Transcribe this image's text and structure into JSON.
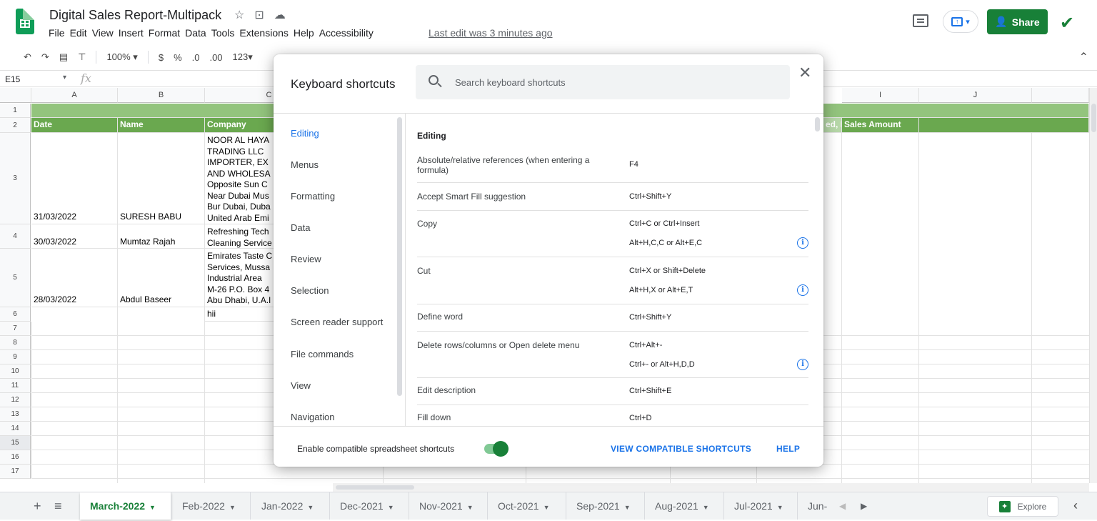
{
  "app": {
    "doc_title": "Digital Sales Report-Multipack",
    "menu": [
      "File",
      "Edit",
      "View",
      "Insert",
      "Format",
      "Data",
      "Tools",
      "Extensions",
      "Help",
      "Accessibility"
    ],
    "last_edit": "Last edit was 3 minutes ago",
    "share_label": "Share"
  },
  "toolbar": {
    "zoom": "100%",
    "currency": "$",
    "percent": "%",
    "dec_less": ".0",
    "dec_more": ".00",
    "format_num": "123"
  },
  "formula_bar": {
    "name_box": "E15",
    "fx": "fx"
  },
  "sheet": {
    "columns": [
      "A",
      "B",
      "C",
      "I",
      "J"
    ],
    "row_numbers": [
      "1",
      "2",
      "3",
      "4",
      "5",
      "6",
      "7",
      "8",
      "9",
      "10",
      "11",
      "12",
      "13",
      "14",
      "15",
      "16",
      "17"
    ],
    "header_row": {
      "a": "Date",
      "b": "Name",
      "c": "Company",
      "h": "ed, P",
      "i": "Sales Amount"
    },
    "rows": [
      {
        "a": "31/03/2022",
        "b": "SURESH BABU",
        "c": "NOOR AL HAYA\nTRADING LLC\nIMPORTER, EX\nAND WHOLESA\nOpposite Sun C\nNear Dubai Mus\nBur Dubai, Duba\nUnited Arab Emi"
      },
      {
        "a": "30/03/2022",
        "b": "Mumtaz Rajah",
        "c": "Refreshing Tech\nCleaning Service"
      },
      {
        "a": "28/03/2022",
        "b": "Abdul Baseer",
        "c": "Emirates Taste C\nServices, Mussa\nIndustrial Area\nM-26 P.O. Box 4\nAbu Dhabi, U.A.I"
      },
      {
        "a": "",
        "b": "",
        "c": "hii"
      }
    ]
  },
  "tabs": {
    "items": [
      "March-2022",
      "Feb-2022",
      "Jan-2022",
      "Dec-2021",
      "Nov-2021",
      "Oct-2021",
      "Sep-2021",
      "Aug-2021",
      "Jul-2021",
      "Jun-"
    ],
    "explore_label": "Explore"
  },
  "dialog": {
    "title": "Keyboard shortcuts",
    "search_placeholder": "Search keyboard shortcuts",
    "categories": [
      "Editing",
      "Menus",
      "Formatting",
      "Data",
      "Review",
      "Selection",
      "Screen reader support",
      "File commands",
      "View",
      "Navigation"
    ],
    "section_title": "Editing",
    "shortcuts": [
      {
        "desc": "Absolute/relative references (when entering a formula)",
        "key1": "F4",
        "key2": "",
        "info": false
      },
      {
        "desc": "Accept Smart Fill suggestion",
        "key1": "Ctrl+Shift+Y",
        "key2": "",
        "info": false
      },
      {
        "desc": "Copy",
        "key1": "Ctrl+C or Ctrl+Insert",
        "key2": "Alt+H,C,C or Alt+E,C",
        "info": true
      },
      {
        "desc": "Cut",
        "key1": "Ctrl+X or Shift+Delete",
        "key2": "Alt+H,X or Alt+E,T",
        "info": true
      },
      {
        "desc": "Define word",
        "key1": "Ctrl+Shift+Y",
        "key2": "",
        "info": false
      },
      {
        "desc": "Delete rows/columns or Open delete menu",
        "key1": "Ctrl+Alt+-",
        "key2": "Ctrl+- or Alt+H,D,D",
        "info": true
      },
      {
        "desc": "Edit description",
        "key1": "Ctrl+Shift+E",
        "key2": "",
        "info": false
      },
      {
        "desc": "Fill down",
        "key1": "Ctrl+D",
        "key2": "",
        "info": false
      }
    ],
    "footer": {
      "toggle_label": "Enable compatible spreadsheet shortcuts",
      "toggle_on": true,
      "view_compat": "VIEW COMPATIBLE SHORTCUTS",
      "help": "HELP"
    }
  },
  "colors": {
    "brand_green": "#188038",
    "header_green": "#6aa84f",
    "band_green": "#93c47d",
    "link_blue": "#1a73e8"
  }
}
